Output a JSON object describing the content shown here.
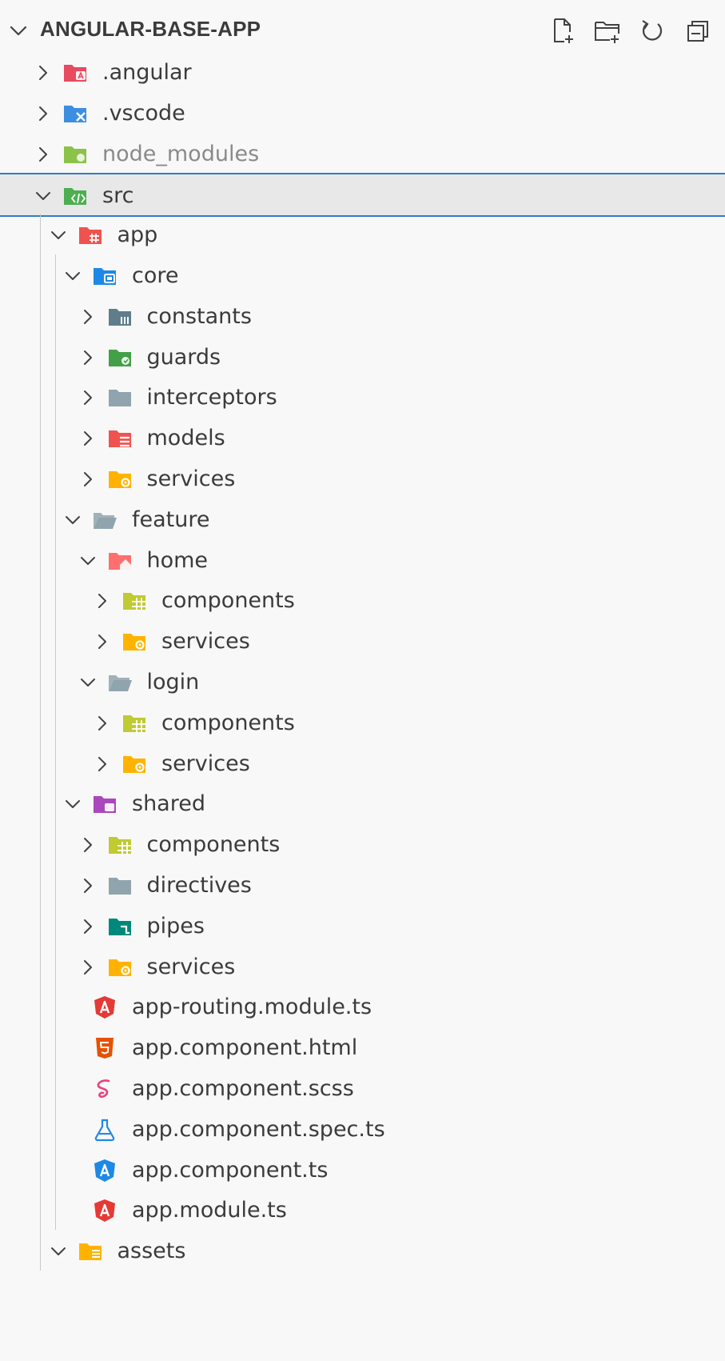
{
  "explorer": {
    "title": "ANGULAR-BASE-APP",
    "actions": [
      {
        "name": "new-file-icon"
      },
      {
        "name": "new-folder-icon"
      },
      {
        "name": "refresh-icon"
      },
      {
        "name": "collapse-all-icon"
      }
    ],
    "tree": [
      {
        "label": ".angular",
        "depth": 0,
        "type": "folder",
        "expanded": false,
        "icon": "folder-angular-icon",
        "color": "#e84a5f"
      },
      {
        "label": ".vscode",
        "depth": 0,
        "type": "folder",
        "expanded": false,
        "icon": "folder-vscode-icon",
        "color": "#3d8ee0"
      },
      {
        "label": "node_modules",
        "depth": 0,
        "type": "folder",
        "expanded": false,
        "icon": "folder-node-icon",
        "color": "#8bc34a",
        "dim": true
      },
      {
        "label": "src",
        "depth": 0,
        "type": "folder",
        "expanded": true,
        "icon": "folder-src-icon",
        "color": "#4caf50",
        "selected": true
      },
      {
        "label": "app",
        "depth": 1,
        "type": "folder",
        "expanded": true,
        "icon": "folder-app-icon",
        "color": "#ef5350"
      },
      {
        "label": "core",
        "depth": 2,
        "type": "folder",
        "expanded": true,
        "icon": "folder-core-icon",
        "color": "#1e88e5"
      },
      {
        "label": "constants",
        "depth": 3,
        "type": "folder",
        "expanded": false,
        "icon": "folder-constants-icon",
        "color": "#607d8b"
      },
      {
        "label": "guards",
        "depth": 3,
        "type": "folder",
        "expanded": false,
        "icon": "folder-guards-icon",
        "color": "#43a047"
      },
      {
        "label": "interceptors",
        "depth": 3,
        "type": "folder",
        "expanded": false,
        "icon": "folder-icon",
        "color": "#90a4ae"
      },
      {
        "label": "models",
        "depth": 3,
        "type": "folder",
        "expanded": false,
        "icon": "folder-models-icon",
        "color": "#ef5350"
      },
      {
        "label": "services",
        "depth": 3,
        "type": "folder",
        "expanded": false,
        "icon": "folder-services-icon",
        "color": "#ffb300"
      },
      {
        "label": "feature",
        "depth": 2,
        "type": "folder",
        "expanded": true,
        "icon": "folder-open-icon",
        "color": "#90a4ae"
      },
      {
        "label": "home",
        "depth": 3,
        "type": "folder",
        "expanded": true,
        "icon": "folder-home-icon",
        "color": "#ff6f6f"
      },
      {
        "label": "components",
        "depth": 4,
        "type": "folder",
        "expanded": false,
        "icon": "folder-components-icon",
        "color": "#c0ca33"
      },
      {
        "label": "services",
        "depth": 4,
        "type": "folder",
        "expanded": false,
        "icon": "folder-services-icon",
        "color": "#ffb300"
      },
      {
        "label": "login",
        "depth": 3,
        "type": "folder",
        "expanded": true,
        "icon": "folder-open-icon",
        "color": "#90a4ae"
      },
      {
        "label": "components",
        "depth": 4,
        "type": "folder",
        "expanded": false,
        "icon": "folder-components-icon",
        "color": "#c0ca33"
      },
      {
        "label": "services",
        "depth": 4,
        "type": "folder",
        "expanded": false,
        "icon": "folder-services-icon",
        "color": "#ffb300"
      },
      {
        "label": "shared",
        "depth": 2,
        "type": "folder",
        "expanded": true,
        "icon": "folder-shared-icon",
        "color": "#ab47bc"
      },
      {
        "label": "components",
        "depth": 3,
        "type": "folder",
        "expanded": false,
        "icon": "folder-components-icon",
        "color": "#c0ca33"
      },
      {
        "label": "directives",
        "depth": 3,
        "type": "folder",
        "expanded": false,
        "icon": "folder-icon",
        "color": "#90a4ae"
      },
      {
        "label": "pipes",
        "depth": 3,
        "type": "folder",
        "expanded": false,
        "icon": "folder-pipes-icon",
        "color": "#00897b"
      },
      {
        "label": "services",
        "depth": 3,
        "type": "folder",
        "expanded": false,
        "icon": "folder-services-icon",
        "color": "#ffb300"
      },
      {
        "label": "app-routing.module.ts",
        "depth": 2,
        "type": "file",
        "icon": "angular-routing-icon",
        "color": "#e53935"
      },
      {
        "label": "app.component.html",
        "depth": 2,
        "type": "file",
        "icon": "html5-icon",
        "color": "#e65100"
      },
      {
        "label": "app.component.scss",
        "depth": 2,
        "type": "file",
        "icon": "sass-icon",
        "color": "#ec407a"
      },
      {
        "label": "app.component.spec.ts",
        "depth": 2,
        "type": "file",
        "icon": "test-flask-icon",
        "color": "#1e88e5"
      },
      {
        "label": "app.component.ts",
        "depth": 2,
        "type": "file",
        "icon": "angular-component-icon",
        "color": "#1e88e5"
      },
      {
        "label": "app.module.ts",
        "depth": 2,
        "type": "file",
        "icon": "angular-module-icon",
        "color": "#e53935"
      },
      {
        "label": "assets",
        "depth": 1,
        "type": "folder",
        "expanded": true,
        "icon": "folder-assets-icon",
        "color": "#ffb300"
      }
    ]
  }
}
